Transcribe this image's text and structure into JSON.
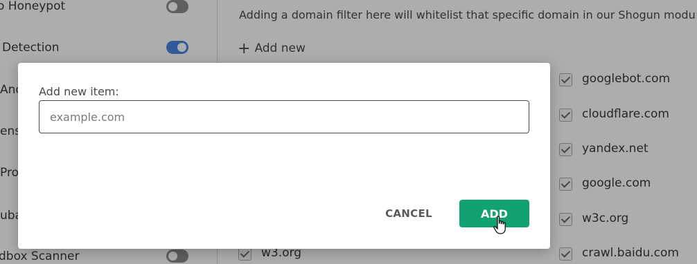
{
  "settings": [
    {
      "label": "o Honeypot",
      "toggle": "off"
    },
    {
      "label": "Detection",
      "toggle": "on"
    },
    {
      "label": "And",
      "toggle": ""
    },
    {
      "label": "ense",
      "toggle": ""
    },
    {
      "label": "Pro",
      "toggle": ""
    },
    {
      "label": "uba",
      "toggle": ""
    },
    {
      "label": "dbox Scanner",
      "toggle": "off"
    }
  ],
  "domain_filter": {
    "info_text": "Adding a domain filter here will whitelist that specific domain in our Shogun modu",
    "add_new_label": "Add new",
    "domains_right": [
      "googlebot.com",
      "cloudflare.com",
      "yandex.net",
      "google.com",
      "w3c.org",
      "crawl.baidu.com"
    ],
    "domains_left": [
      "w3.org"
    ]
  },
  "modal": {
    "label": "Add new item:",
    "input_value": "",
    "input_placeholder": "example.com",
    "cancel_label": "CANCEL",
    "add_label": "ADD"
  },
  "colors": {
    "accent_toggle": "#4a83e6",
    "add_button": "#12a172"
  }
}
